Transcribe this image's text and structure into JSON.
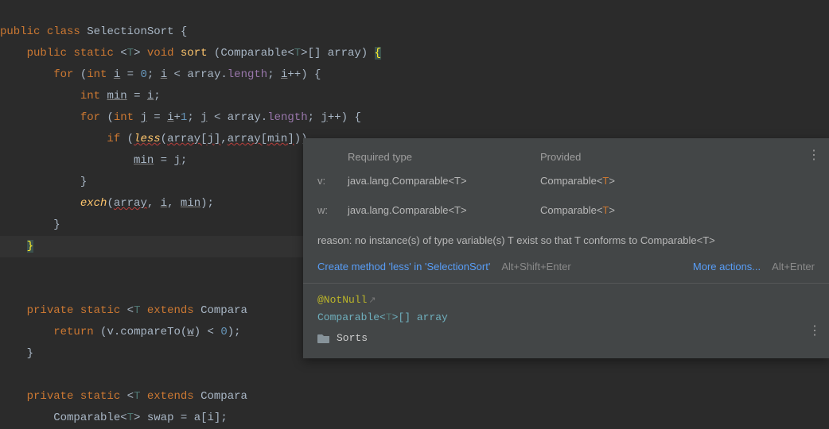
{
  "code": {
    "kw_public": "public",
    "kw_class": "class",
    "cls": "SelectionSort",
    "ob": "{",
    "kw_static": "static",
    "generic_open": "<",
    "T": "T",
    "generic_close": ">",
    "kw_void": "void",
    "m_sort": "sort",
    "paren_o": "(",
    "Comparable": "Comparable",
    "arr_suffix": "[] ",
    "array": "array",
    "paren_c": ")",
    "ob2": "{",
    "kw_for": "for",
    "kw_int": "int",
    "i": "i",
    "eq": " = ",
    "zero": "0",
    "semi": "; ",
    "lt": " < ",
    "dot": ".",
    "length": "length",
    "inc": "++",
    "cb": "}",
    "min": "min",
    "j": "j",
    "plus1": "+",
    "one": "1",
    "kw_if": "if",
    "less": "less",
    "br_o": "[",
    "br_c": "]",
    "comma": ",",
    "exch": "exch",
    "kw_private": "private",
    "kw_extends": "extends",
    "Compara": "Compara",
    "kw_return": "return",
    "v": "v",
    "compareTo": "compareTo",
    "w": "w",
    "swap": "swap",
    "a": "a"
  },
  "tooltip": {
    "header_req": "Required type",
    "header_prov": "Provided",
    "row1_label": "v:",
    "row1_req": "java.lang.Comparable<T>",
    "row1_prov_pre": "Comparable<",
    "row1_prov_t": "T",
    "row1_prov_post": ">",
    "row2_label": "w:",
    "row2_req": "java.lang.Comparable<T>",
    "row2_prov_pre": "Comparable<",
    "row2_prov_t": "T",
    "row2_prov_post": ">",
    "reason": "reason: no instance(s) of type variable(s) T exist so that T conforms to Comparable<T>",
    "quickfix": "Create method 'less' in 'SelectionSort'",
    "quickfix_sc": "Alt+Shift+Enter",
    "more": "More actions...",
    "more_sc": "Alt+Enter",
    "annot": "@NotNull",
    "extarrow": "↗",
    "sig_pre": "Comparable<",
    "sig_t": "T",
    "sig_post": ">[] array",
    "breadcrumb": "Sorts"
  }
}
